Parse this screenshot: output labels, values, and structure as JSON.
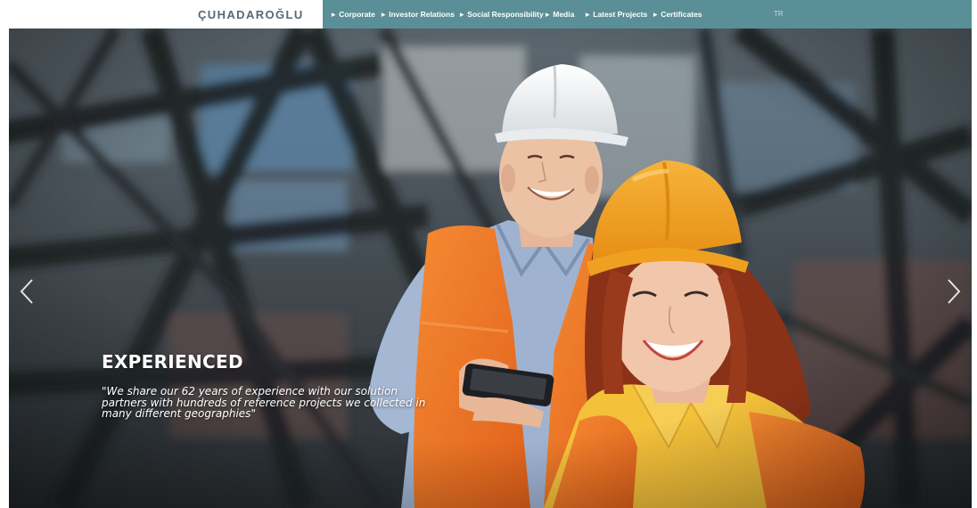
{
  "header": {
    "logo_text": "ÇUHADAROĞLU",
    "nav": [
      {
        "label": "Corporate"
      },
      {
        "label": "Investor Relations"
      },
      {
        "label": "Social Responsibility"
      },
      {
        "label": "Media"
      },
      {
        "label": "Latest Projects"
      },
      {
        "label": "Certificates"
      }
    ],
    "language": "TR"
  },
  "slider": {
    "title": "EXPERIENCED",
    "quote": "\"We share our 62 years of experience with our solution partners with hundreds of reference projects we collected in many different geographies\"",
    "prev_icon": "chevron-left-icon",
    "next_icon": "chevron-right-icon"
  },
  "colors": {
    "nav_background": "#5b8f97",
    "logo": "#5a6873",
    "vest_orange": "#f07a22",
    "helmet_orange": "#f39a1c"
  }
}
